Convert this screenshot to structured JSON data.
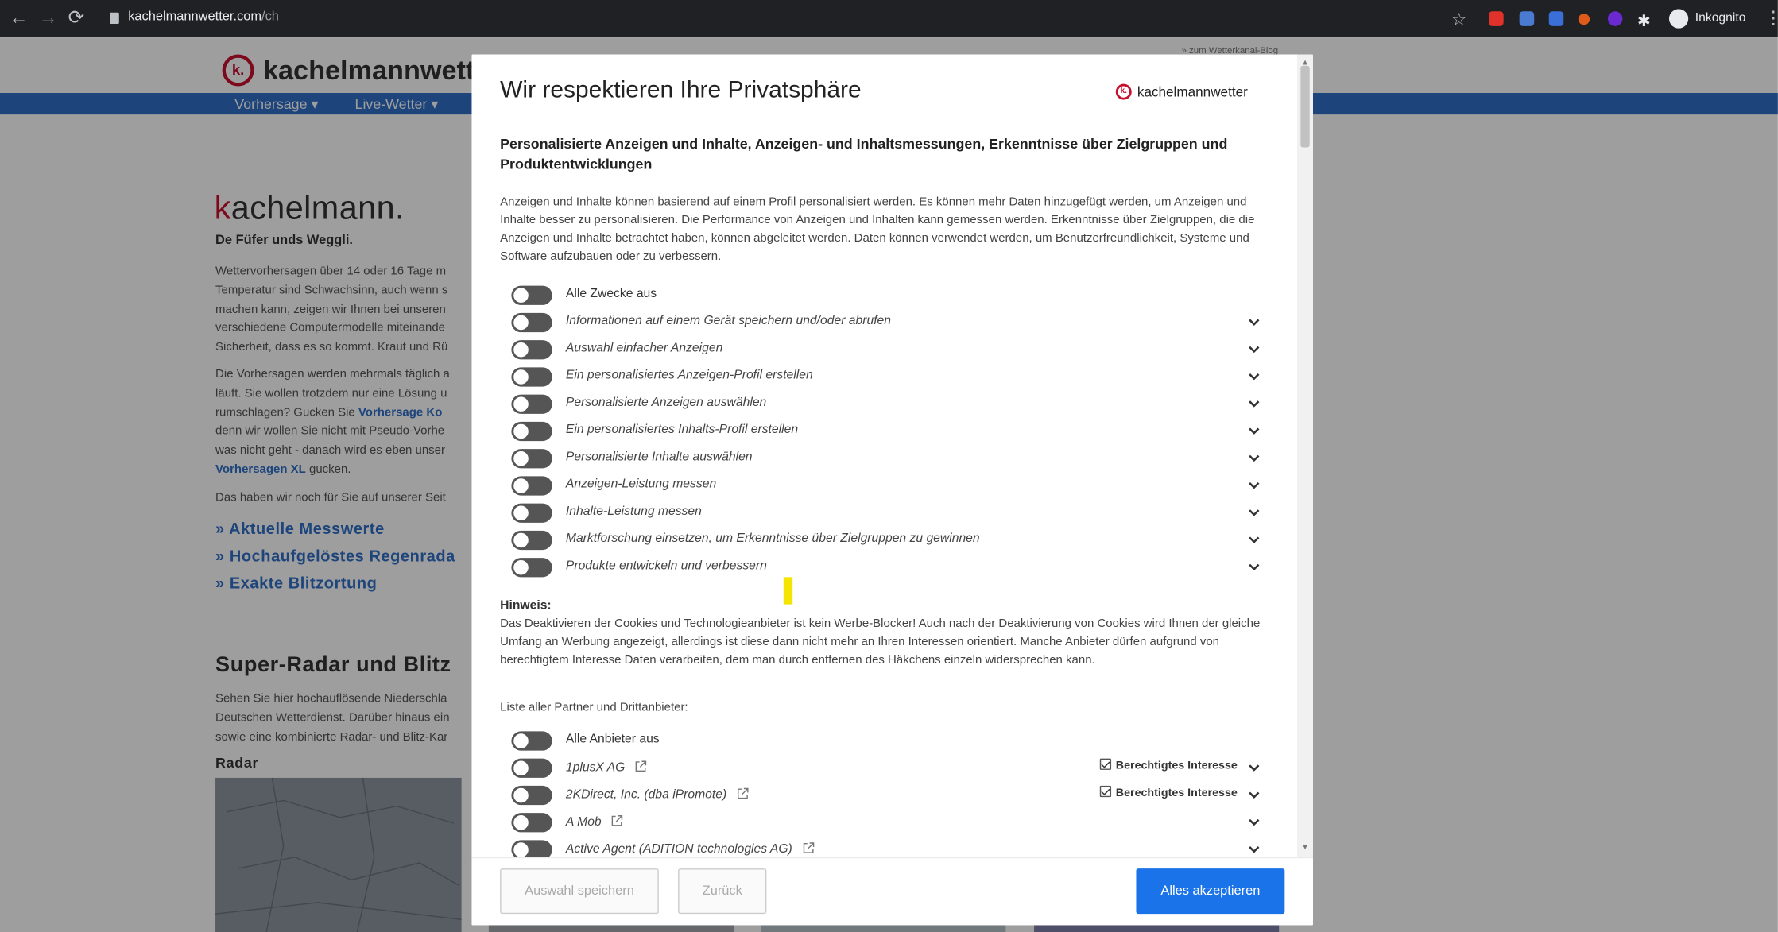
{
  "browser": {
    "back_glyph": "←",
    "forward_glyph": "→",
    "reload_glyph": "⟳",
    "url_host": "kachelmannwetter.com",
    "url_path": "/ch",
    "star_glyph": "☆",
    "puzzle_glyph": "✱",
    "incognito_label": "Inkognito",
    "menu_glyph": "⋮",
    "extension_colors": [
      "#e0322a",
      "#4a7bd0",
      "#3a6fd8",
      "#e05a1a",
      "#6a2ad0"
    ]
  },
  "site": {
    "logo_letter": "k.",
    "logo_text": "kachelmannwette",
    "top_note": "» zum Wetterkanal-Blog",
    "nav": [
      "Vorhersage ▾",
      "Live-Wetter ▾"
    ],
    "brand_first": "k",
    "brand_rest": "achelmann.",
    "tagline": "De Füfer unds Weggli.",
    "para1": [
      "Wettervorhersagen über 14 oder 16 Tage m",
      "Temperatur sind Schwachsinn, auch wenn s",
      "machen kann, zeigen wir Ihnen bei unseren",
      "verschiedene Computermodelle miteinande",
      "Sicherheit, dass es so kommt. Kraut und Rü"
    ],
    "para2_lines": [
      "Die Vorhersagen werden mehrmals täglich a",
      "läuft. Sie wollen trotzdem nur eine Lösung u"
    ],
    "para2_pre": "rumschlagen? Gucken Sie ",
    "para2_link1": "Vorhersage Ko",
    "para2_line4": "denn wir wollen Sie nicht mit Pseudo-Vorhe",
    "para2_line5": "was nicht geht - danach wird es eben unser",
    "para2_link2": "Vorhersagen XL",
    "para2_post": " gucken.",
    "para3": "Das haben wir noch für Sie auf unserer Seit",
    "links": [
      "» Aktuelle Messwerte",
      "» Hochaufgelöstes Regenrada",
      "» Exakte Blitzortung"
    ],
    "radar_heading": "Super-Radar und Blitz",
    "radar_para": [
      "Sehen Sie hier hochauflösende Niederschla",
      "Deutschen Wetterdienst. Darüber hinaus ein",
      "sowie eine kombinierte Radar- und Blitz-Kar"
    ],
    "radar_label": "Radar"
  },
  "modal": {
    "title": "Wir respektieren Ihre Privatsphäre",
    "brand_letter": "k.",
    "brand": "kachelmannwetter",
    "heading": "Personalisierte Anzeigen und Inhalte, Anzeigen- und Inhaltsmessungen, Erkenntnisse über Zielgruppen und Produktentwicklungen",
    "description": "Anzeigen und Inhalte können basierend auf einem Profil personalisiert werden. Es können mehr Daten hinzugefügt werden, um Anzeigen und Inhalte besser zu personalisieren. Die Performance von Anzeigen und Inhalten kann gemessen werden. Erkenntnisse über Zielgruppen, die die Anzeigen und Inhalte betrachtet haben, können abgeleitet werden. Daten können verwendet werden, um Benutzerfreundlichkeit, Systeme und Software aufzubauen oder zu verbessern.",
    "all_purposes": "Alle Zwecke aus",
    "purposes": [
      "Informationen auf einem Gerät speichern und/oder abrufen",
      "Auswahl einfacher Anzeigen",
      "Ein personalisiertes Anzeigen-Profil erstellen",
      "Personalisierte Anzeigen auswählen",
      "Ein personalisiertes Inhalts-Profil erstellen",
      "Personalisierte Inhalte auswählen",
      "Anzeigen-Leistung messen",
      "Inhalte-Leistung messen",
      "Marktforschung einsetzen, um Erkenntnisse über Zielgruppen zu gewinnen",
      "Produkte entwickeln und verbessern"
    ],
    "note_heading": "Hinweis:",
    "note": "Das Deaktivieren der Cookies und Technologieanbieter ist kein Werbe-Blocker! Auch nach der Deaktivierung von Cookies wird Ihnen der gleiche Umfang an Werbung angezeigt, allerdings ist diese dann nicht mehr an Ihren Interessen orientiert. Manche Anbieter dürfen aufgrund von berechtigtem Interesse Daten verarbeiten, dem man durch entfernen des Häkchens einzeln widersprechen kann.",
    "partners_heading": "Liste aller Partner und Drittanbieter:",
    "all_vendors": "Alle Anbieter aus",
    "vendors": [
      {
        "name": "1plusX AG",
        "legit": "Berechtigtes Interesse"
      },
      {
        "name": "2KDirect, Inc. (dba iPromote)",
        "legit": "Berechtigtes Interesse"
      },
      {
        "name": "A Mob",
        "legit": ""
      },
      {
        "name": "Active Agent (ADITION technologies AG)",
        "legit": ""
      }
    ],
    "save_button": "Auswahl speichern",
    "back_button": "Zurück",
    "accept_button": "Alles akzeptieren"
  }
}
